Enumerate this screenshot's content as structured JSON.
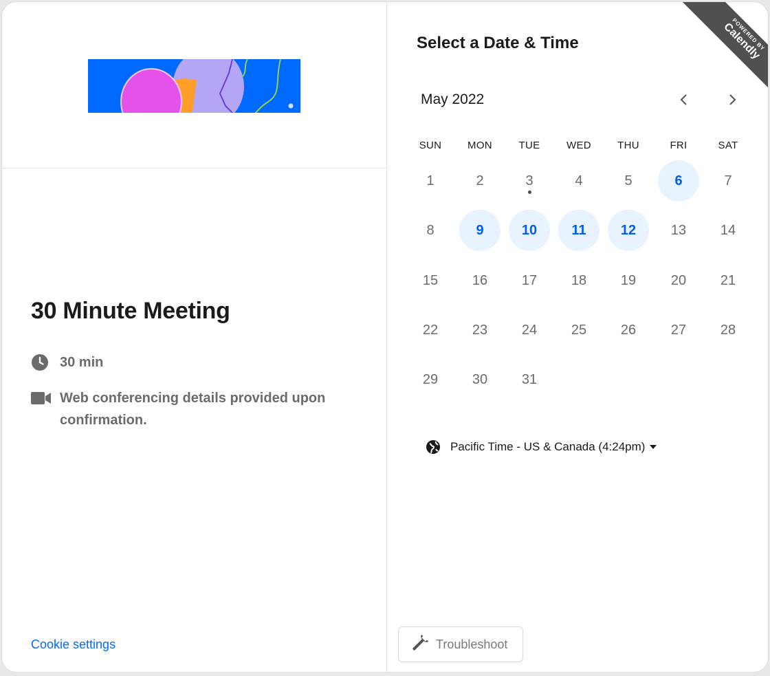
{
  "event": {
    "title": "30 Minute Meeting",
    "duration": "30 min",
    "conferencing": "Web conferencing details provided upon confirmation."
  },
  "footer": {
    "cookie_link": "Cookie settings",
    "troubleshoot_label": "Troubleshoot"
  },
  "calendar": {
    "section_title": "Select a Date & Time",
    "month_label": "May 2022",
    "weekdays": [
      "SUN",
      "MON",
      "TUE",
      "WED",
      "THU",
      "FRI",
      "SAT"
    ],
    "first_weekday_index": 0,
    "days_in_month": 31,
    "today": 3,
    "available_days": [
      6,
      9,
      10,
      11,
      12
    ],
    "prev_label": "‹",
    "next_label": "›"
  },
  "timezone": {
    "label": "Pacific Time - US & Canada (4:24pm)"
  },
  "branding": {
    "powered_by": "POWERED BY",
    "brand": "Calendly"
  },
  "icons": {
    "clock": "clock-icon",
    "video": "video-camera-icon",
    "globe": "globe-icon",
    "wrench": "wrench-icon",
    "caret": "caret-down-icon",
    "prev": "chevron-left-icon",
    "next": "chevron-right-icon"
  },
  "colors": {
    "accent": "#0069ff",
    "available_bg": "#e9f2ff",
    "available_text": "#0060e6",
    "ribbon": "#505050"
  }
}
